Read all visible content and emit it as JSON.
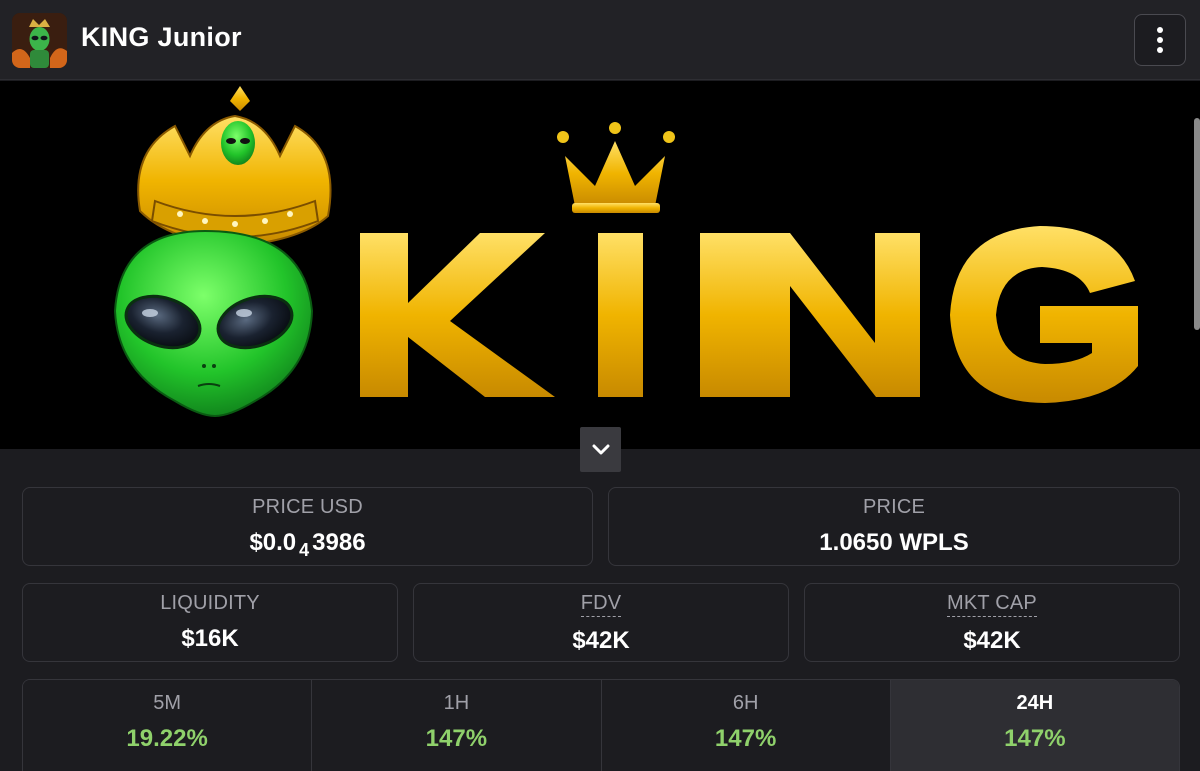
{
  "header": {
    "title": "KING Junior",
    "avatar_icon": "alien-king-avatar",
    "menu_icon": "more-vertical-icon"
  },
  "banner": {
    "logo_text": "KING",
    "collapse_icon": "chevron-down-icon"
  },
  "stats_row1": [
    {
      "label": "PRICE USD",
      "value_prefix": "$0.0",
      "value_subscript": "4",
      "value_suffix": "3986"
    },
    {
      "label": "PRICE",
      "value": "1.0650 WPLS"
    }
  ],
  "stats_row2": [
    {
      "label": "LIQUIDITY",
      "value": "$16K"
    },
    {
      "label": "FDV",
      "value": "$42K"
    },
    {
      "label": "MKT CAP",
      "value": "$42K"
    }
  ],
  "periods": [
    {
      "label": "5M",
      "value": "19.22%"
    },
    {
      "label": "1H",
      "value": "147%"
    },
    {
      "label": "6H",
      "value": "147%"
    },
    {
      "label": "24H",
      "value": "147%",
      "active": true
    }
  ],
  "colors": {
    "positive": "#8fd16b",
    "gold": "#f0c419",
    "alien_green": "#2ecc40"
  }
}
